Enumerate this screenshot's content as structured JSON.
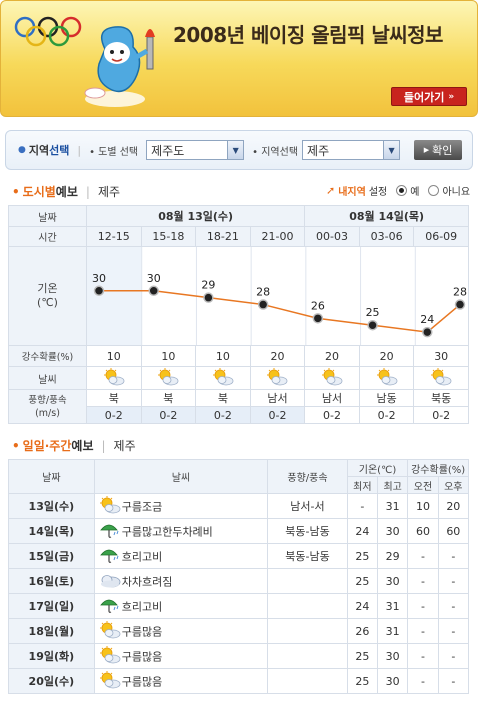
{
  "banner": {
    "title": "2008년 베이징 올림픽 날씨정보",
    "go_label": "들어가기"
  },
  "selector": {
    "region_label_plain": "지역",
    "region_label_bold": "선택",
    "province_label": "도별 선택",
    "province_value": "제주도",
    "area_label": "지역선택",
    "area_value": "제주",
    "confirm_label": "확인"
  },
  "city_section": {
    "title_orange": "도시별",
    "title_rest": " 예보",
    "city": "제주",
    "myset_label_em": "내지역",
    "myset_label_rest": "설정",
    "yes_label": "예",
    "no_label": "아니요"
  },
  "forecast": {
    "row_labels": {
      "date": "날짜",
      "time": "시간",
      "temp": "기온\n(℃)",
      "rain": "강수확률(%)",
      "weather": "날씨",
      "wind": "풍향/풍속\n(m/s)"
    },
    "dates": [
      "08월 13일(수)",
      "08월 14일(목)"
    ],
    "times": [
      "12-15",
      "15-18",
      "18-21",
      "21-00",
      "00-03",
      "03-06",
      "06-09"
    ],
    "rain": [
      "10",
      "10",
      "10",
      "20",
      "20",
      "20",
      "30"
    ],
    "wind_dir": [
      "북",
      "북",
      "북",
      "남서",
      "남서",
      "남동",
      "북동"
    ],
    "wind_speed": [
      "0-2",
      "0-2",
      "0-2",
      "0-2",
      "0-2",
      "0-2",
      "0-2"
    ],
    "weather_icons": [
      "sun-cloud-icon",
      "sun-cloud-icon",
      "sun-cloud-icon",
      "sun-cloud-icon",
      "sun-cloud-icon",
      "sun-cloud-icon",
      "sun-cloud-icon"
    ]
  },
  "chart_data": {
    "type": "line",
    "categories": [
      "12-15",
      "15-18",
      "18-21",
      "21-00",
      "00-03",
      "03-06",
      "06-09"
    ],
    "values": [
      30,
      30,
      29,
      28,
      26,
      25,
      24,
      28
    ],
    "point_labels": [
      "30",
      "30",
      "29",
      "28",
      "26",
      "25",
      "24",
      "28"
    ],
    "ylabel": "기온\n(℃)",
    "ylim": [
      23,
      32
    ],
    "colors": {
      "line": "#e87722",
      "point": "#222222"
    }
  },
  "weekly_section": {
    "title_orange": "일일·주간",
    "title_rest": "예보",
    "city": "제주"
  },
  "weekly": {
    "headers": {
      "date": "날짜",
      "weather": "날씨",
      "wind": "풍향/풍속",
      "temp": "기온(℃)",
      "rain": "강수확률(%)",
      "min": "최저",
      "max": "최고",
      "am": "오전",
      "pm": "오후"
    },
    "rows": [
      {
        "day": "13일(수)",
        "icon": "sun-cloud-icon",
        "weather": "구름조금",
        "wind": "남서-서",
        "min": "-",
        "max": "31",
        "am": "10",
        "pm": "20"
      },
      {
        "day": "14일(목)",
        "icon": "umbrella-icon",
        "weather": "구름많고한두차례비",
        "wind": "북동-남동",
        "min": "24",
        "max": "30",
        "am": "60",
        "pm": "60"
      },
      {
        "day": "15일(금)",
        "icon": "umbrella-icon",
        "weather": "흐리고비",
        "wind": "북동-남동",
        "min": "25",
        "max": "29",
        "am": "-",
        "pm": "-"
      },
      {
        "day": "16일(토)",
        "icon": "cloud-icon",
        "weather": "차차흐려짐",
        "wind": "",
        "min": "25",
        "max": "30",
        "am": "-",
        "pm": "-"
      },
      {
        "day": "17일(일)",
        "icon": "umbrella-icon",
        "weather": "흐리고비",
        "wind": "",
        "min": "24",
        "max": "31",
        "am": "-",
        "pm": "-"
      },
      {
        "day": "18일(월)",
        "icon": "sun-cloud-icon",
        "weather": "구름많음",
        "wind": "",
        "min": "26",
        "max": "31",
        "am": "-",
        "pm": "-"
      },
      {
        "day": "19일(화)",
        "icon": "sun-cloud-icon",
        "weather": "구름많음",
        "wind": "",
        "min": "25",
        "max": "30",
        "am": "-",
        "pm": "-"
      },
      {
        "day": "20일(수)",
        "icon": "sun-cloud-icon",
        "weather": "구름많음",
        "wind": "",
        "min": "25",
        "max": "30",
        "am": "-",
        "pm": "-"
      }
    ]
  }
}
